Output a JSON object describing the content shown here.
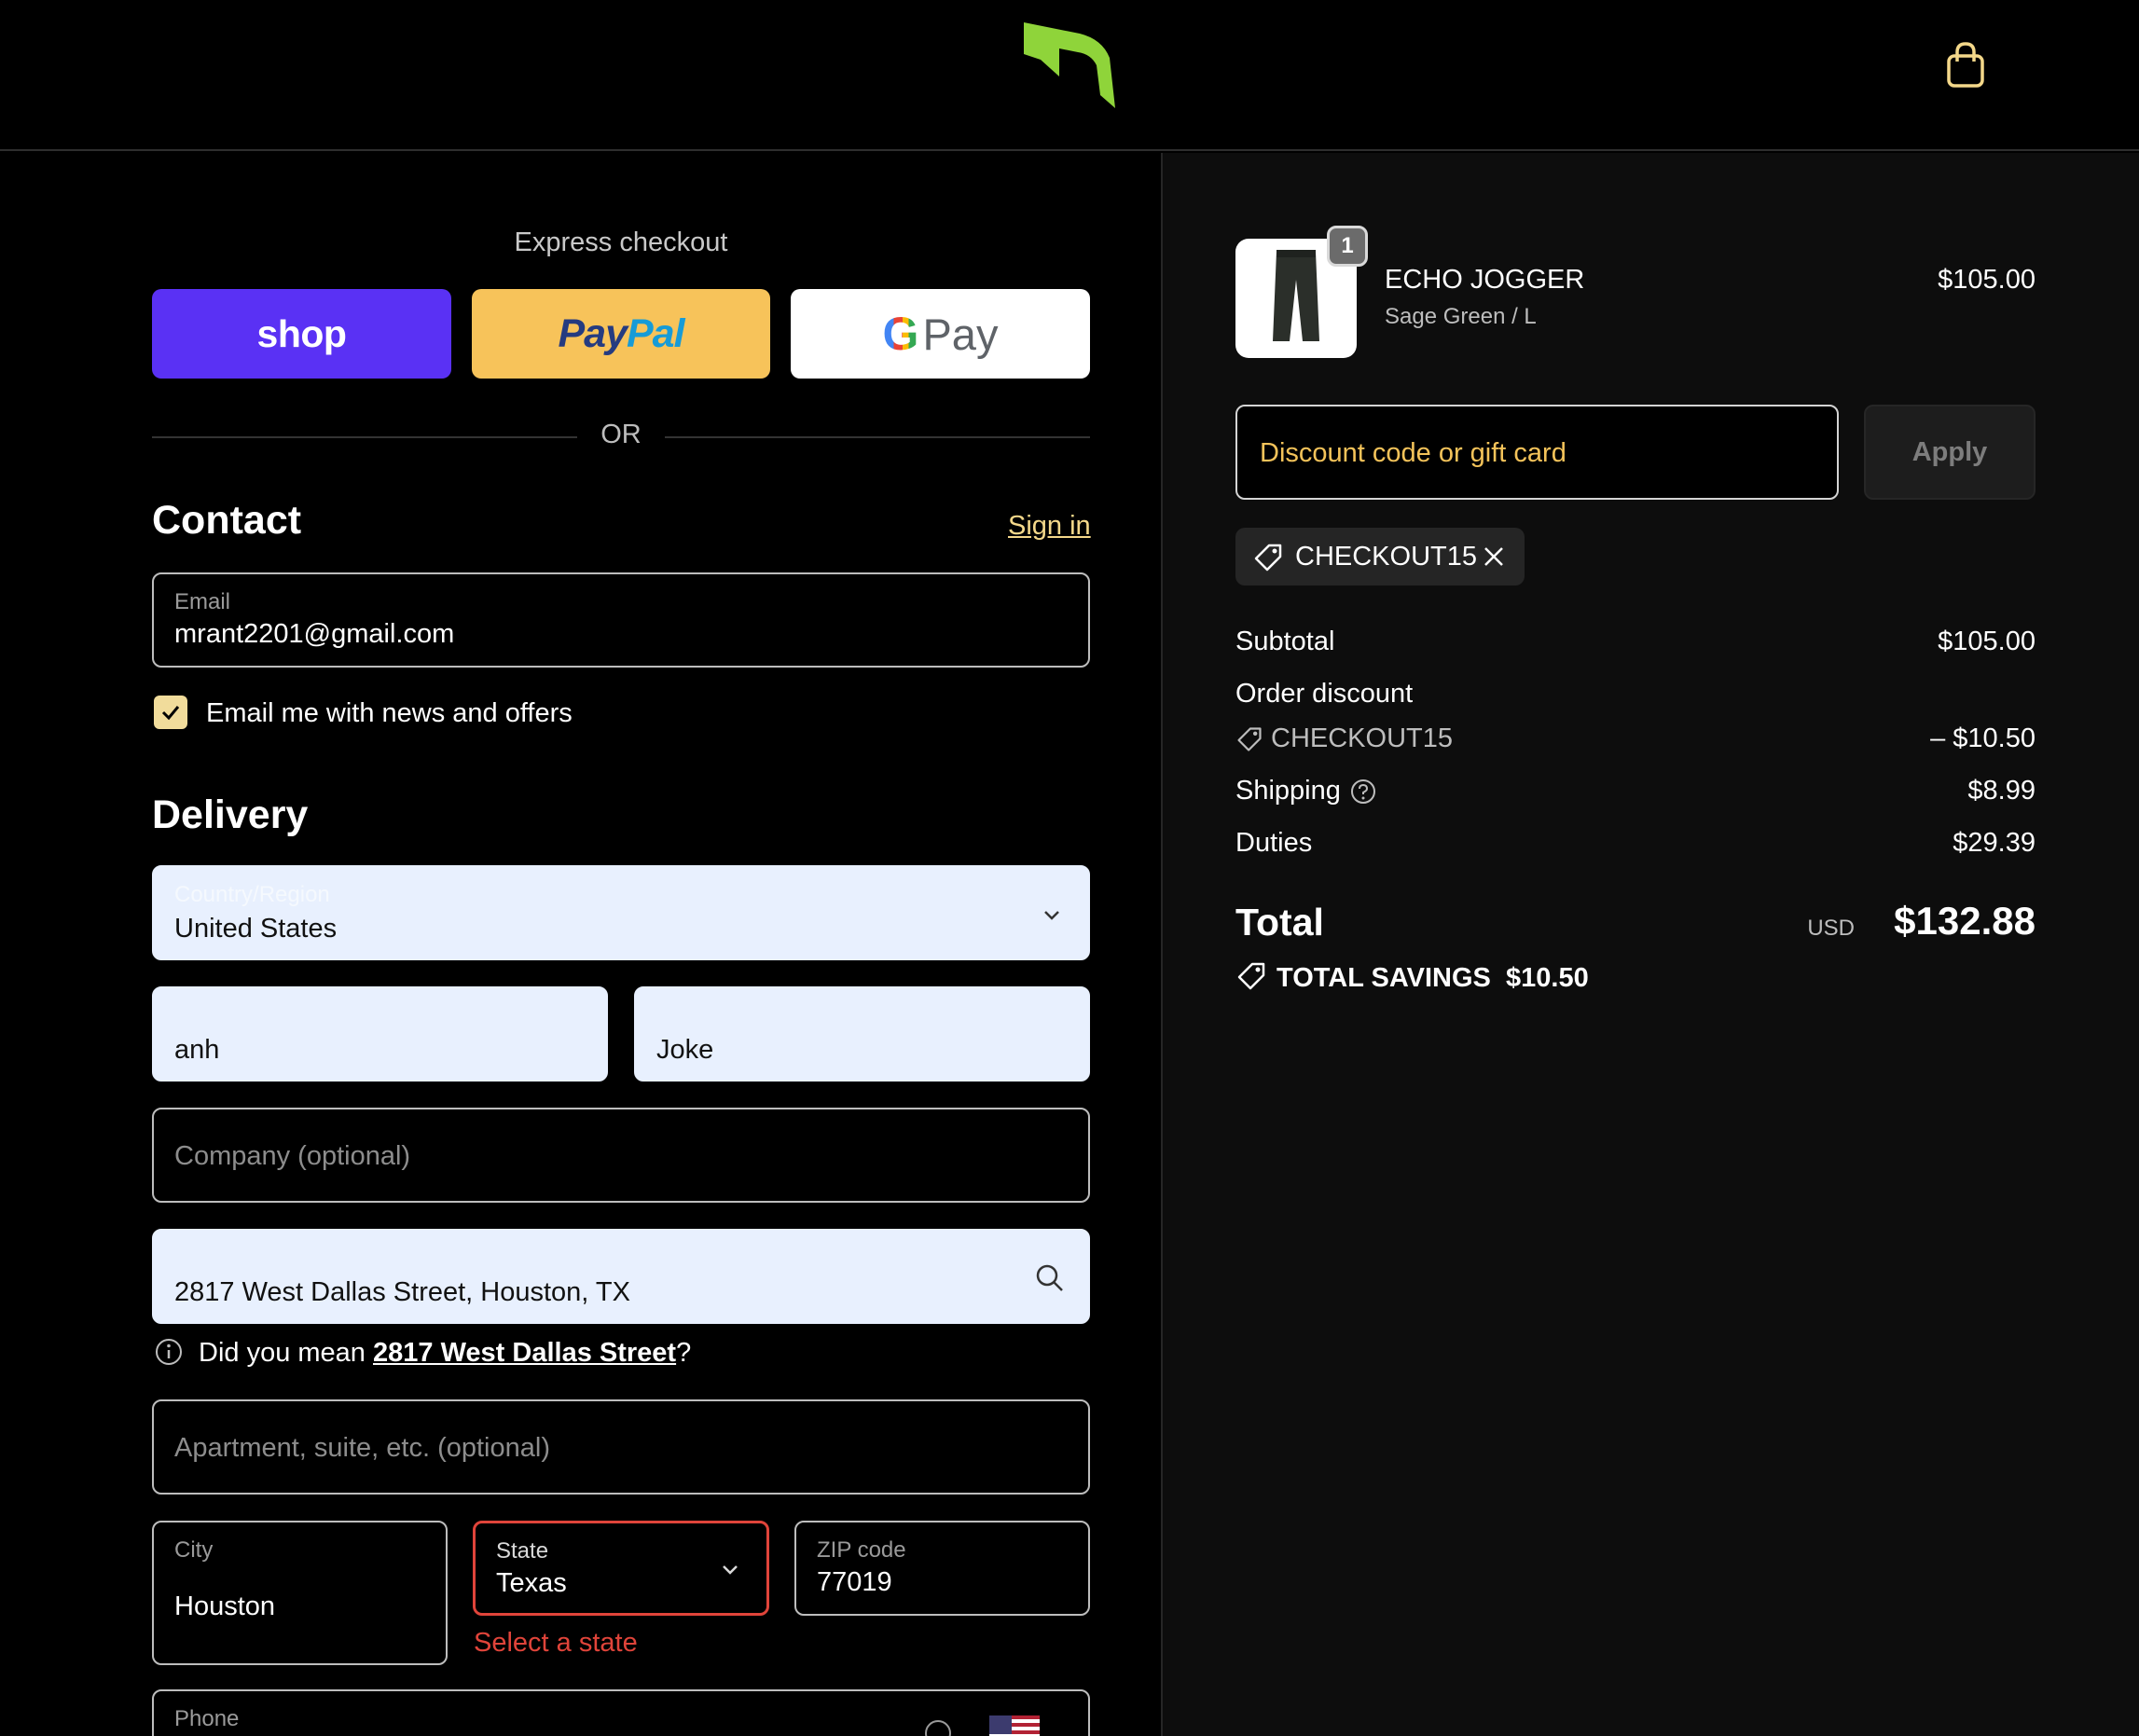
{
  "header": {
    "logo_icon": "brand-logo-icon",
    "cart_icon": "shopping-bag-icon"
  },
  "express": {
    "title": "Express checkout",
    "shop_label": "shop",
    "paypal_label_dark": "Pay",
    "paypal_label_light": "Pal",
    "gpay_g": "G",
    "gpay_label": "Pay",
    "or_label": "OR"
  },
  "contact": {
    "title": "Contact",
    "sign_in": "Sign in",
    "email_label": "Email",
    "email_value": "mrant2201@gmail.com",
    "newsletter_label": "Email me with news and offers",
    "newsletter_checked": true
  },
  "delivery": {
    "title": "Delivery",
    "country_label": "Country/Region",
    "country_value": "United States",
    "first_name_value": "anh",
    "last_name_value": "Joke",
    "company_placeholder": "Company (optional)",
    "address_value": "2817 West Dallas Street, Houston, TX",
    "suggestion_prefix": "Did you mean ",
    "suggestion_link": "2817 West Dallas Street",
    "suggestion_suffix": "?",
    "apartment_placeholder": "Apartment, suite, etc. (optional)",
    "city_label": "City",
    "city_value": "Houston",
    "state_label": "State",
    "state_value": "Texas",
    "state_error": "Select a state",
    "zip_label": "ZIP code",
    "zip_value": "77019",
    "phone_label": "Phone"
  },
  "summary": {
    "product": {
      "name": "ECHO JOGGER",
      "variant": "Sage Green / L",
      "price": "$105.00",
      "quantity": "1"
    },
    "discount_placeholder": "Discount code or gift card",
    "apply_label": "Apply",
    "applied_code": "CHECKOUT15",
    "subtotal_label": "Subtotal",
    "subtotal_value": "$105.00",
    "order_discount_label": "Order discount",
    "order_discount_code": "CHECKOUT15",
    "order_discount_value": "– $10.50",
    "shipping_label": "Shipping",
    "shipping_value": "$8.99",
    "duties_label": "Duties",
    "duties_value": "$29.39",
    "total_label": "Total",
    "currency": "USD",
    "total_value": "$132.88",
    "savings_label": "TOTAL SAVINGS",
    "savings_value": "$10.50"
  },
  "colors": {
    "shop_purple": "#5a31f4",
    "paypal_yellow": "#f7c35a",
    "accent_gold": "#f1dc9b",
    "error_red": "#e0443a",
    "autofill_blue": "#e8f0fe",
    "logo_green": "#8fd43a"
  }
}
